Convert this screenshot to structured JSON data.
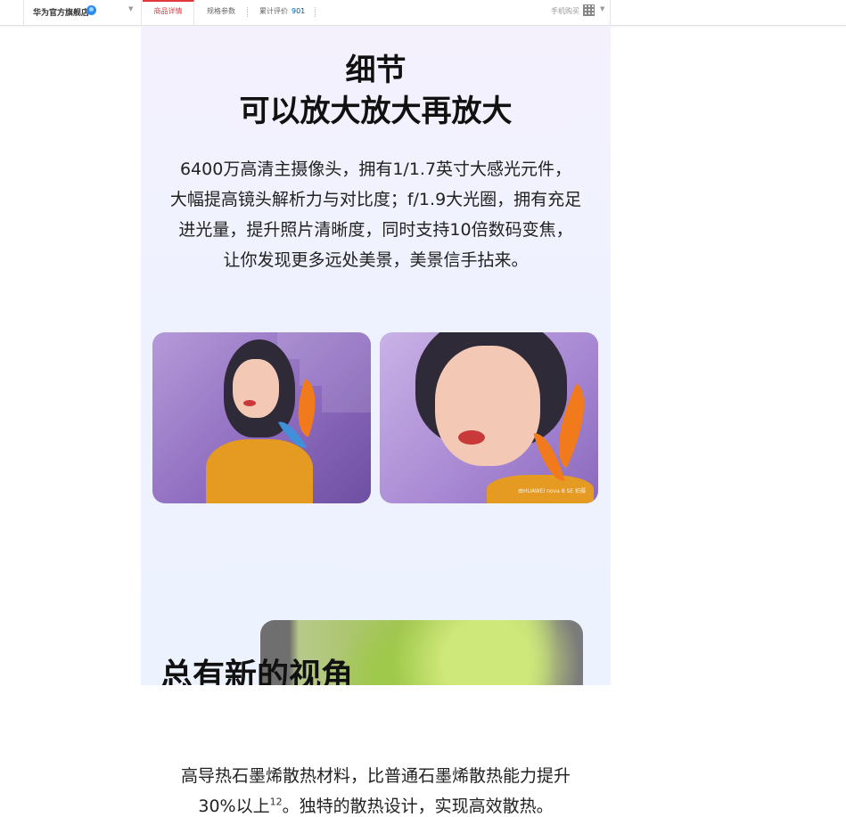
{
  "topbar": {
    "store_name": "华为官方旗舰店",
    "tabs": {
      "detail": "商品详情",
      "spec": "规格参数",
      "review_label": "累计评价",
      "review_count": "901"
    },
    "mobile_buy": "手机购买"
  },
  "content": {
    "title_line1": "细节",
    "title_line2": "可以放大放大再放大",
    "description": [
      "6400万高清主摄像头，拥有1/1.7英寸大感光元件，",
      "大幅提高镜头解析力与对比度；f/1.9大光圈，拥有充足",
      "进光量，提升照片清晰度，同时支持10倍数码变焦，",
      "让你发现更多远处美景，美景信手拈来。"
    ],
    "photo_caption": "由HUAWEI nova 8 SE 拍摄",
    "section2_title": "总有新的视角",
    "bottom_line1": "高导热石墨烯散热材料，比普通石墨烯散热能力提升",
    "bottom_line2_pre": "30%以上",
    "bottom_line2_sup": "12",
    "bottom_line2_post": "。独特的散热设计，实现高效散热。"
  },
  "colors": {
    "accent": "#e4393c",
    "link": "#005aa0"
  }
}
